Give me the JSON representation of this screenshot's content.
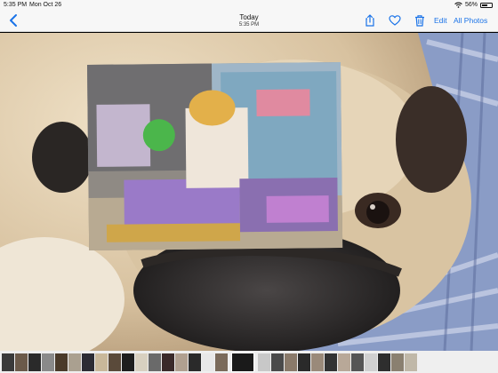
{
  "status": {
    "time": "5:35 PM",
    "date": "Mon Oct 26",
    "battery": "56%",
    "battery_level": 0.56
  },
  "nav": {
    "title": "Today",
    "subtitle": "5:35 PM",
    "edit_label": "Edit",
    "all_photos_label": "All Photos"
  },
  "colors": {
    "accent": "#1a73e8",
    "bar": "#f7f7f7"
  },
  "icons": [
    "back-chevron-icon",
    "share-icon",
    "heart-icon",
    "trash-icon",
    "wifi-icon",
    "battery-icon"
  ],
  "filmstrip": {
    "thumbs": [
      "#3a3a3a",
      "#6b5a4a",
      "#2a2a2a",
      "#8a8a8a",
      "#4a3a2a",
      "#aaa090",
      "#2c2c34",
      "#c9b89a",
      "#5a4a3a",
      "#1e1e1e",
      "#d8d0c0",
      "#6a6a6a",
      "#3a2a2a",
      "#b0a090",
      "#2a2a2a",
      "#e8e8e8",
      "#7a6a5a",
      "#1a1a1a",
      "#c8c8c8",
      "#4a4a4a",
      "#8a7a6a",
      "#2a2a2a",
      "#9a8a7a",
      "#333",
      "#b8a898",
      "#555",
      "#d0d0d0",
      "#2e2e2e",
      "#8a8070",
      "#c0b8a8"
    ],
    "selected_index": 17
  }
}
